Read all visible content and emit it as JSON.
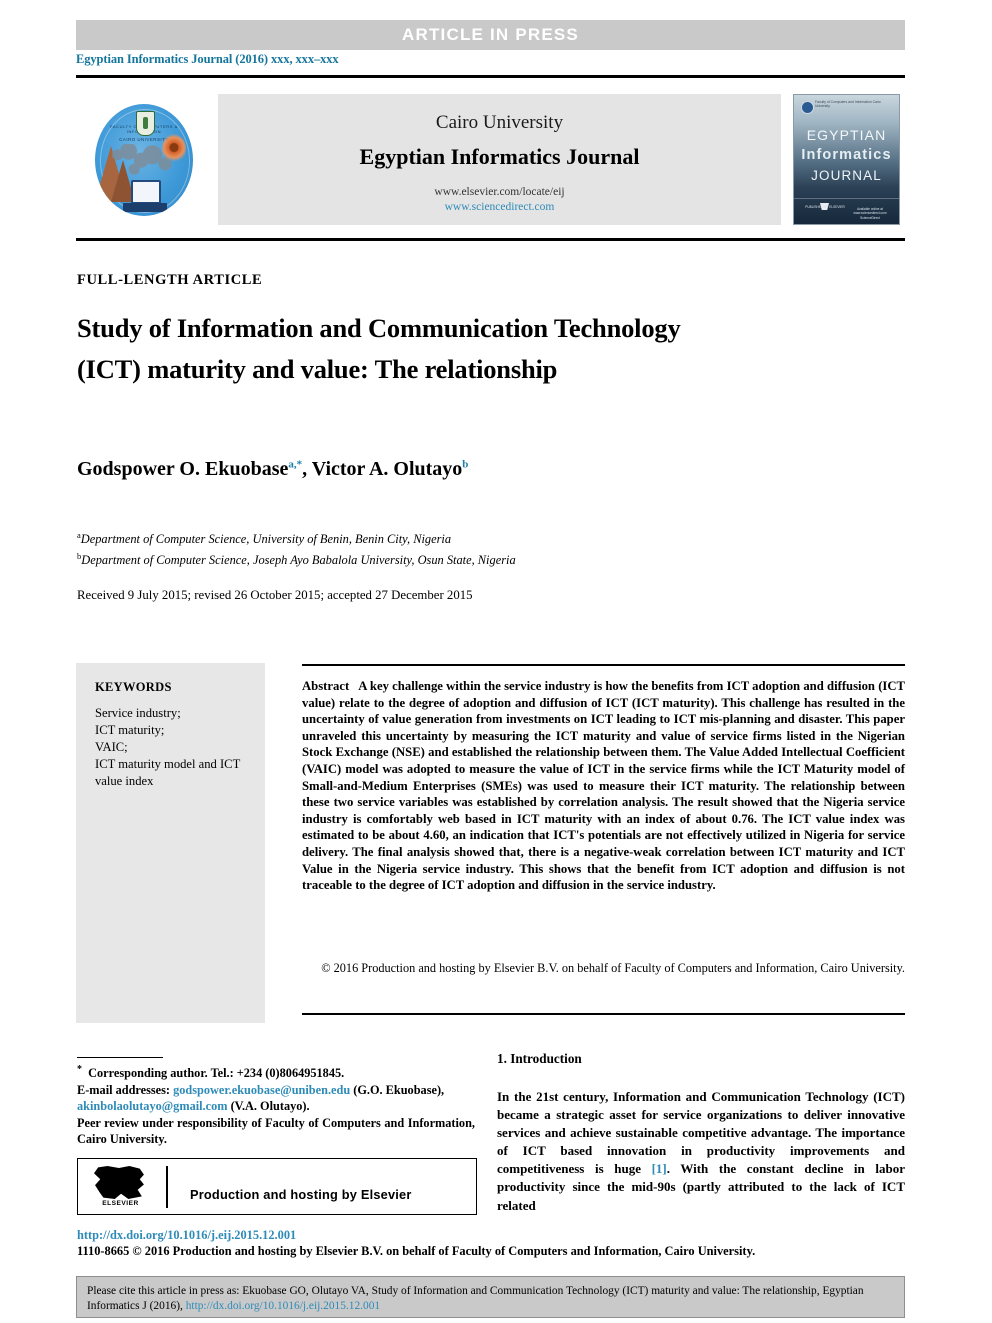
{
  "banner": {
    "article_in_press": "ARTICLE  IN  PRESS",
    "journal_reference": "Egyptian Informatics Journal (2016) xxx, xxx–xxx"
  },
  "masthead": {
    "university": "Cairo University",
    "journal_title": "Egyptian Informatics Journal",
    "url_elsevier": "www.elsevier.com/locate/eij",
    "url_sciencedirect": "www.sciencedirect.com",
    "logo_top_text": "FACULTY OF COMPUTERS & INFORMATION",
    "logo_mid_text": "CAIRO UNIVERSITY",
    "cover": {
      "line1": "EGYPTIAN",
      "line2": "Informatics",
      "line3": "JOURNAL",
      "emblem_text": "Faculty of Computers and Information Cairo University",
      "foot_left": "PUBLISHED BY ELSEVIER",
      "foot_right": "Available online at www.sciencedirect.com ScienceDirect"
    }
  },
  "article": {
    "kicker": "FULL-LENGTH ARTICLE",
    "title": "Study of Information and Communication Technology (ICT) maturity and value: The relationship",
    "authors": [
      {
        "name": "Godspower O. Ekuobase",
        "marks": "a,*"
      },
      {
        "name": "Victor A. Olutayo",
        "marks": "b"
      }
    ],
    "authors_separator": ", ",
    "affiliations": [
      {
        "mark": "a",
        "text": "Department of Computer Science, University of Benin, Benin City, Nigeria"
      },
      {
        "mark": "b",
        "text": "Department of Computer Science, Joseph Ayo Babalola University, Osun State, Nigeria"
      }
    ],
    "history": "Received 9 July 2015; revised 26 October 2015; accepted 27 December 2015"
  },
  "keywords": {
    "heading": "KEYWORDS",
    "items": "Service industry;\nICT maturity;\nVAIC;\nICT maturity model and ICT value index"
  },
  "abstract": {
    "label": "Abstract",
    "body": "A key challenge within the service industry is how the benefits from ICT adoption and diffusion (ICT value) relate to the degree of adoption and diffusion of ICT (ICT maturity). This challenge has resulted in the uncertainty of value generation from investments on ICT leading to ICT mis-planning and disaster. This paper unraveled this uncertainty by measuring the ICT maturity and value of service firms listed in the Nigerian Stock Exchange (NSE) and established the relationship between them. The Value Added Intellectual Coefficient (VAIC) model was adopted to measure the value of ICT in the service firms while the ICT Maturity model of Small-and-Medium Enterprises (SMEs) was used to measure their ICT maturity. The relationship between these two service variables was established by correlation analysis. The result showed that the Nigeria service industry is comfortably web based in ICT maturity with an index of about 0.76. The ICT value index was estimated to be about 4.60, an indication that ICT's potentials are not effectively utilized in Nigeria for service delivery. The final analysis showed that, there is a negative-weak correlation between ICT maturity and ICT Value in the Nigeria service industry. This shows that the benefit from ICT adoption and diffusion is not traceable to the degree of ICT adoption and diffusion in the service industry.",
    "copyright": "© 2016 Production and hosting by Elsevier B.V. on behalf of Faculty of Computers and Information, Cairo University."
  },
  "footnotes": {
    "corresponding": "Corresponding author. Tel.: +234 (0)8064951845.",
    "email_label": "E-mail addresses:",
    "email1": "godspower.ekuobase@uniben.edu",
    "email1_owner": "(G.O. Ekuobase),",
    "email2": "akinbolaolutayo@gmail.com",
    "email2_owner": "(V.A. Olutayo).",
    "peer_review": "Peer review under responsibility of Faculty of Computers and Information, Cairo University."
  },
  "elsevier_badge": {
    "wordmark": "ELSEVIER",
    "text": "Production and hosting by Elsevier"
  },
  "publication": {
    "doi": "http://dx.doi.org/10.1016/j.eij.2015.12.001",
    "issn_line": "1110-8665 © 2016 Production and hosting by Elsevier B.V. on behalf of Faculty of Computers and Information, Cairo University."
  },
  "introduction": {
    "heading": "1. Introduction",
    "paragraph_part1": "In the 21st century, Information and Communication Technology (ICT) became a strategic asset for service organizations to deliver innovative services and achieve sustainable competitive advantage. The importance of ICT based innovation in productivity improvements and competitiveness is huge ",
    "reference": "[1]",
    "paragraph_part2": ". With the constant decline in labor productivity since the mid-90s (partly attributed to the lack of ICT related"
  },
  "citation_footer": {
    "text_part1": "Please cite this article in press as: Ekuobase GO, Olutayo VA, Study of Information and Communication Technology (ICT) maturity and value: The relationship, Egyptian Informatics J (2016), ",
    "link": "http://dx.doi.org/10.1016/j.eij.2015.12.001"
  },
  "colors": {
    "banner_gray": "#c9c9c9",
    "link_blue": "#2e8bb8",
    "journal_ref_blue": "#15769c",
    "masthead_gray": "#e4e4e4",
    "keywords_gray": "#e7e7e7"
  }
}
